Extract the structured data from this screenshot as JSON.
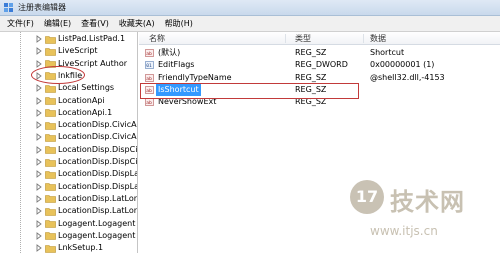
{
  "window": {
    "title": "注册表编辑器"
  },
  "menu": [
    "文件(F)",
    "编辑(E)",
    "查看(V)",
    "收藏夹(A)",
    "帮助(H)"
  ],
  "tree": {
    "items": [
      "ListPad.ListPad.1",
      "LiveScript",
      "LiveScript Author",
      "lnkfile",
      "Local Settings",
      "LocationApi",
      "LocationApi.1",
      "LocationDisp.CivicAd",
      "LocationDisp.CivicAd",
      "LocationDisp.DispCi",
      "LocationDisp.DispCi",
      "LocationDisp.DispLa",
      "LocationDisp.DispLa",
      "LocationDisp.LatLor",
      "LocationDisp.LatLor",
      "Logagent.Logagent",
      "Logagent.Logagent",
      "LnkSetup.1"
    ]
  },
  "list": {
    "headers": {
      "name": "名称",
      "type": "类型",
      "data": "数据"
    },
    "rows": [
      {
        "name": "(默认)",
        "type": "REG_SZ",
        "data": "Shortcut",
        "icon": "string-value-icon"
      },
      {
        "name": "EditFlags",
        "type": "REG_DWORD",
        "data": "0x00000001 (1)",
        "icon": "binary-value-icon"
      },
      {
        "name": "FriendlyTypeName",
        "type": "REG_SZ",
        "data": "@shell32.dll,-4153",
        "icon": "string-value-icon"
      },
      {
        "name": "IsShortcut",
        "type": "REG_SZ",
        "data": "",
        "icon": "string-value-icon",
        "selected": true
      },
      {
        "name": "NeverShowExt",
        "type": "REG_SZ",
        "data": "",
        "icon": "string-value-icon"
      }
    ]
  },
  "watermark": {
    "logo": "17",
    "text": "技术网",
    "url": "www.itjs.cn"
  },
  "colors": {
    "selection": "#3399ff",
    "annotation": "#c23a3a",
    "folder": "#e8c25a"
  }
}
